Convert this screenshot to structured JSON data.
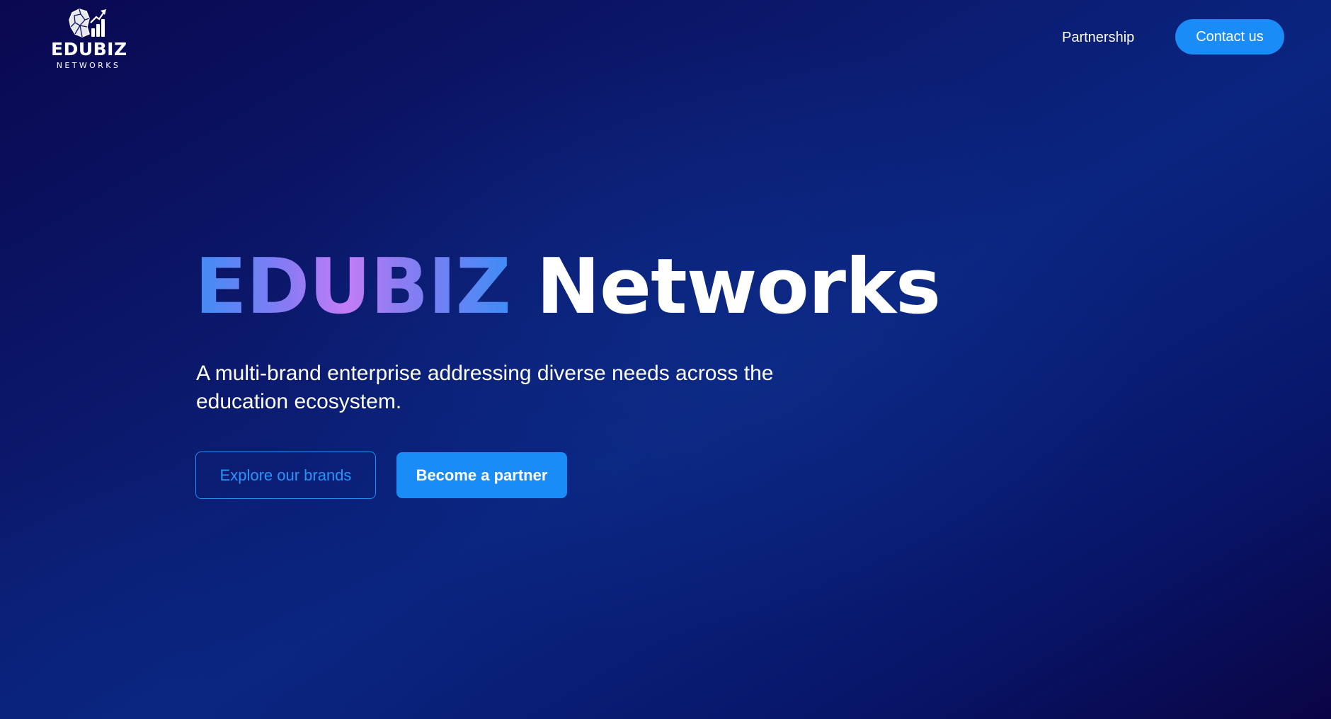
{
  "header": {
    "logo": {
      "title": "EDUBIZ",
      "subtitle": "NETWORKS",
      "icon": "brain-chart-icon"
    },
    "nav": {
      "partnership_label": "Partnership"
    },
    "contact_label": "Contact us"
  },
  "hero": {
    "title_brand": "EDUBIZ",
    "title_rest": "Networks",
    "subtitle": "A multi-brand enterprise addressing diverse needs across the education ecosystem.",
    "explore_label": "Explore our brands",
    "partner_label": "Become a partner"
  },
  "colors": {
    "accent": "#1a8cf7",
    "background_dark": "#0a0850",
    "background_mid": "#0a2580",
    "gradient_blue": "#3f8cf5",
    "gradient_purple": "#c37cf6"
  }
}
